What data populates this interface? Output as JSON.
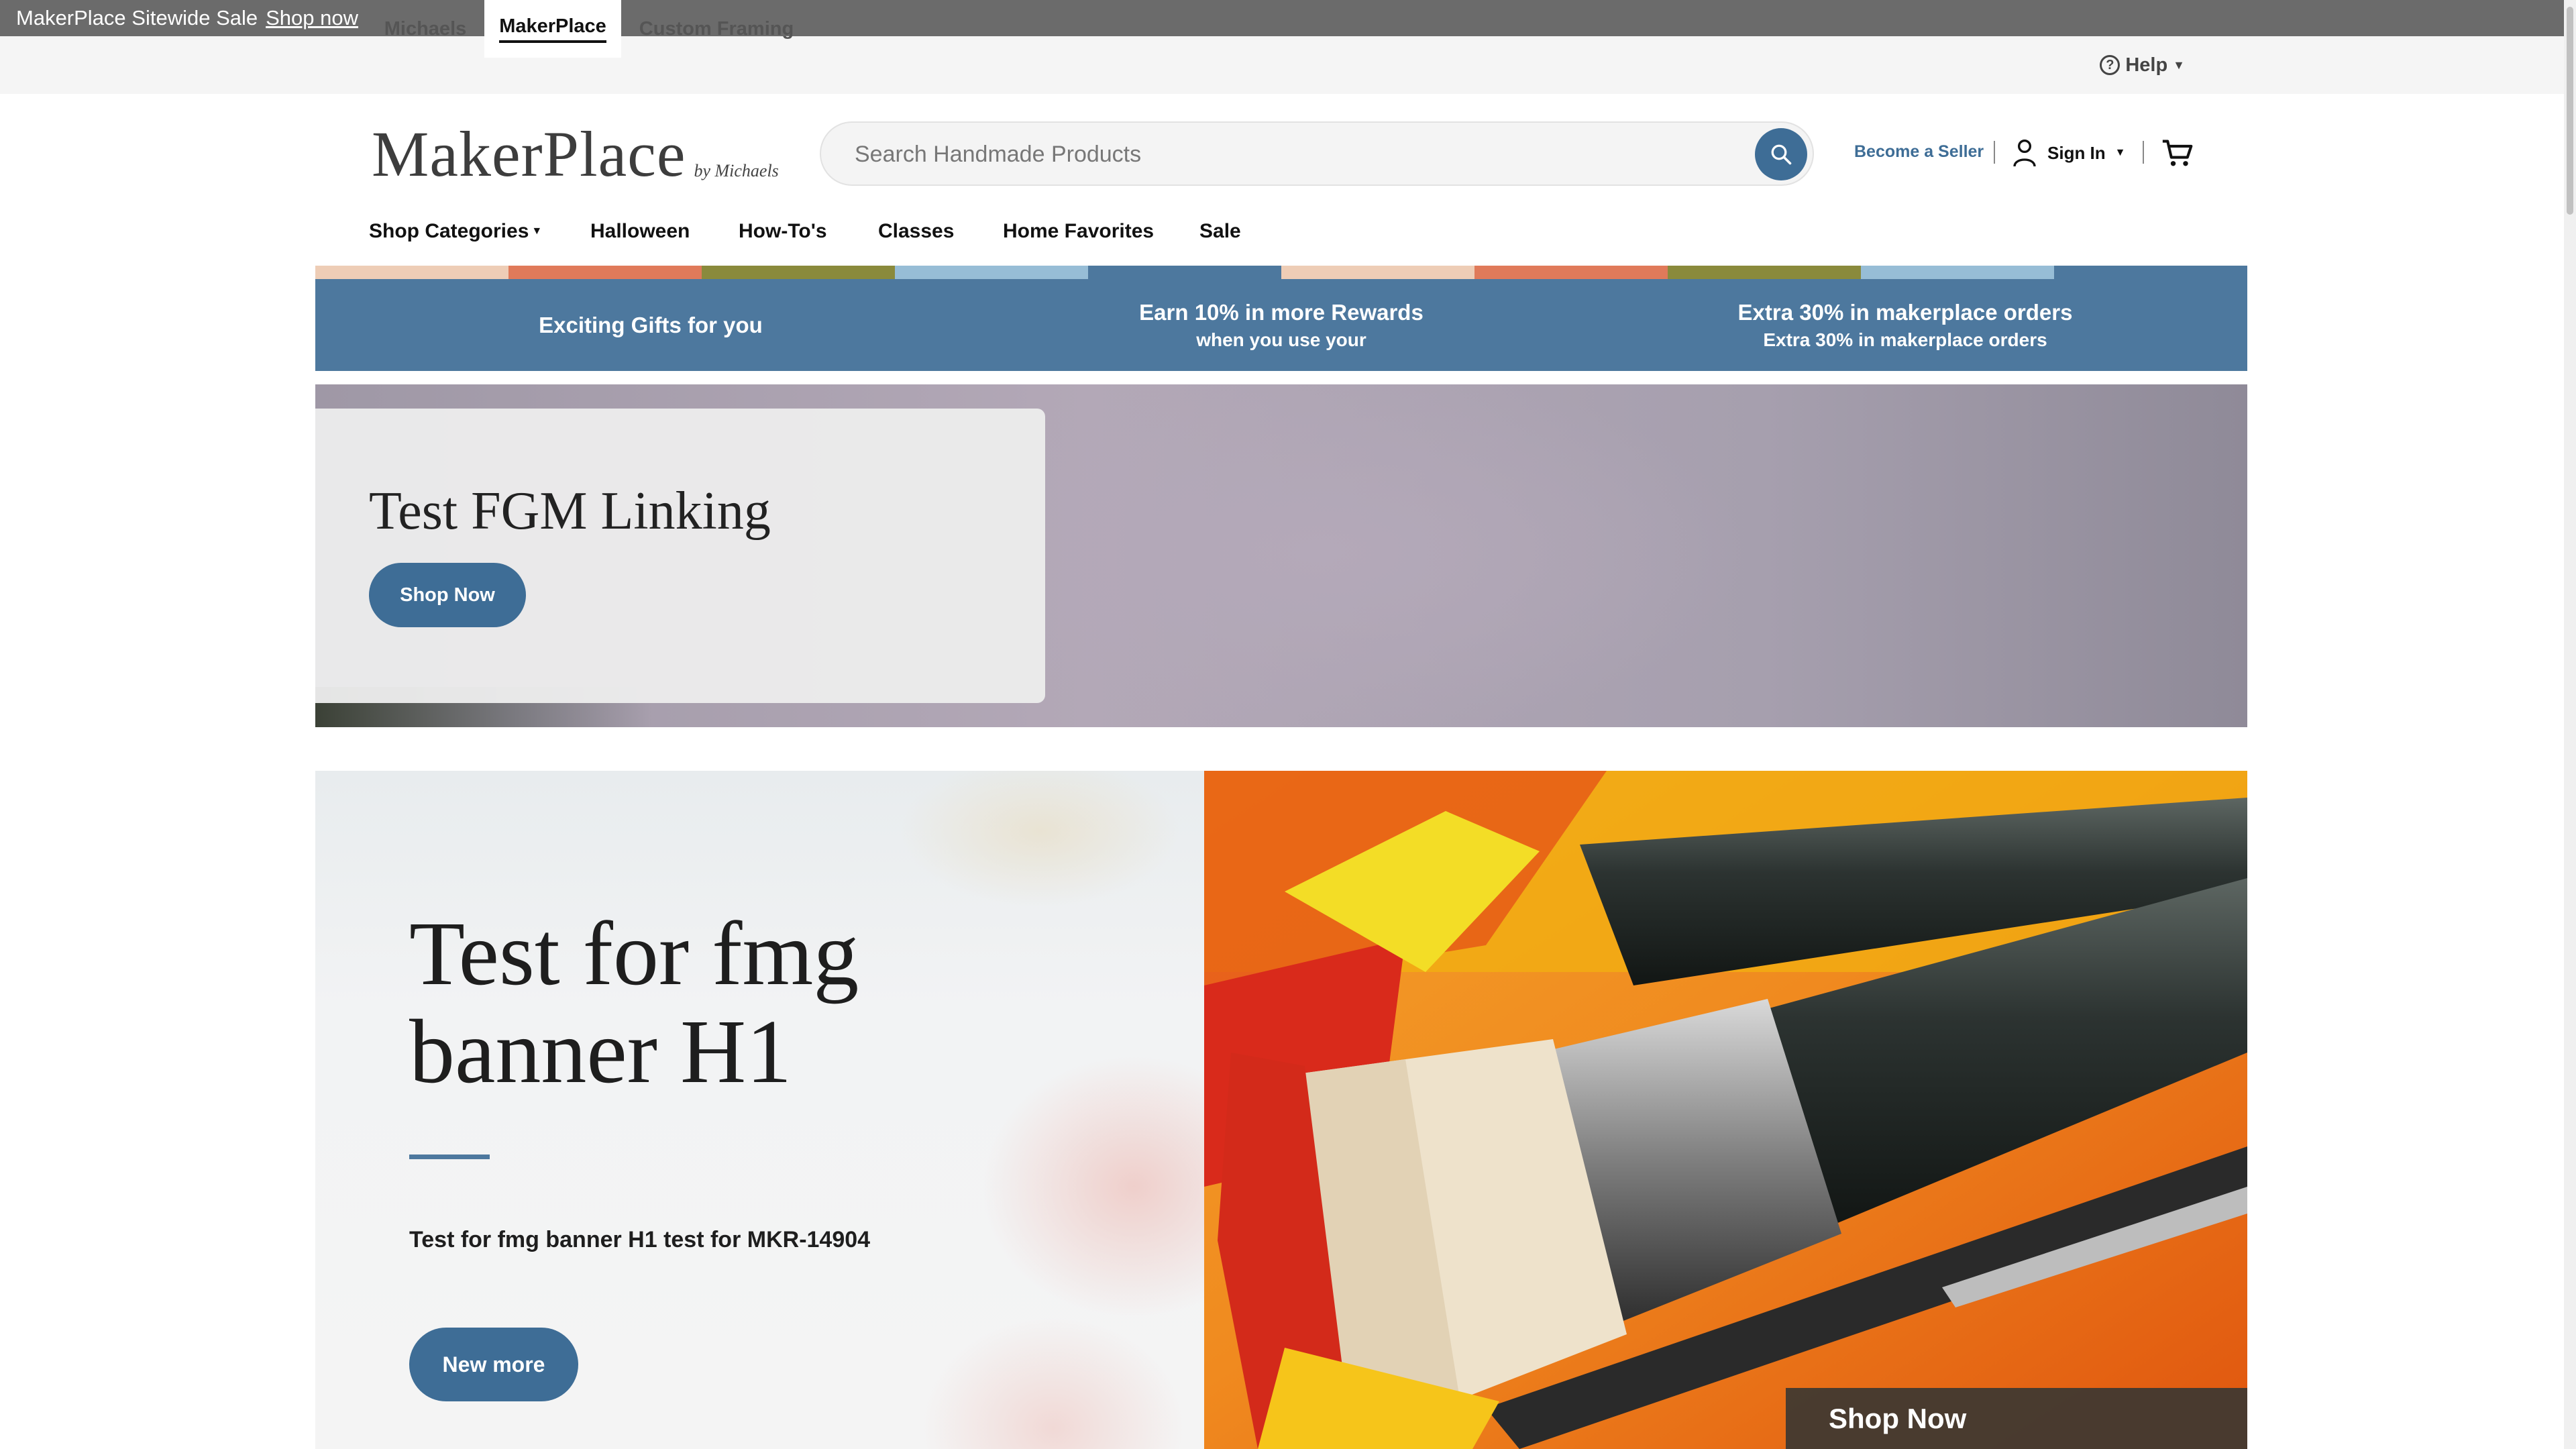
{
  "promo_bar": {
    "text": "MakerPlace Sitewide Sale",
    "link": "Shop now"
  },
  "site_switcher": {
    "tabs": [
      {
        "label": "Michaels",
        "active": false
      },
      {
        "label": "MakerPlace",
        "active": true
      },
      {
        "label": "Custom Framing",
        "active": false
      }
    ],
    "help_label": "Help"
  },
  "header": {
    "logo_word": "MakerPlace",
    "logo_by": "by Michaels",
    "search_placeholder": "Search Handmade Products",
    "become_seller": "Become a Seller",
    "sign_in": "Sign In"
  },
  "nav": {
    "items": [
      "Shop Categories",
      "Halloween",
      "How-To's",
      "Classes",
      "Home Favorites",
      "Sale"
    ]
  },
  "rewards": [
    {
      "title": "Exciting Gifts for you",
      "subtitle": ""
    },
    {
      "title": "Earn 10% in more Rewards",
      "subtitle": "when you use your"
    },
    {
      "title": "Extra 30% in makerplace orders",
      "subtitle": "Extra 30% in makerplace orders"
    }
  ],
  "hero1": {
    "heading": "Test FGM Linking",
    "button": "Shop Now"
  },
  "hero2": {
    "heading_line1": "Test for fmg",
    "heading_line2": "banner H1",
    "body": "Test for fmg banner H1 test for MKR-14904",
    "button": "New more",
    "overlay_cta": "Shop Now"
  },
  "colors": {
    "brand_blue": "#3e6d96",
    "rewards_bg": "#4d789e",
    "promo_bg": "#6b6b6b",
    "stripe": [
      "#eecdb6",
      "#e07a5a",
      "#8a8a3c",
      "#97bdd6",
      "#4d789e"
    ]
  }
}
